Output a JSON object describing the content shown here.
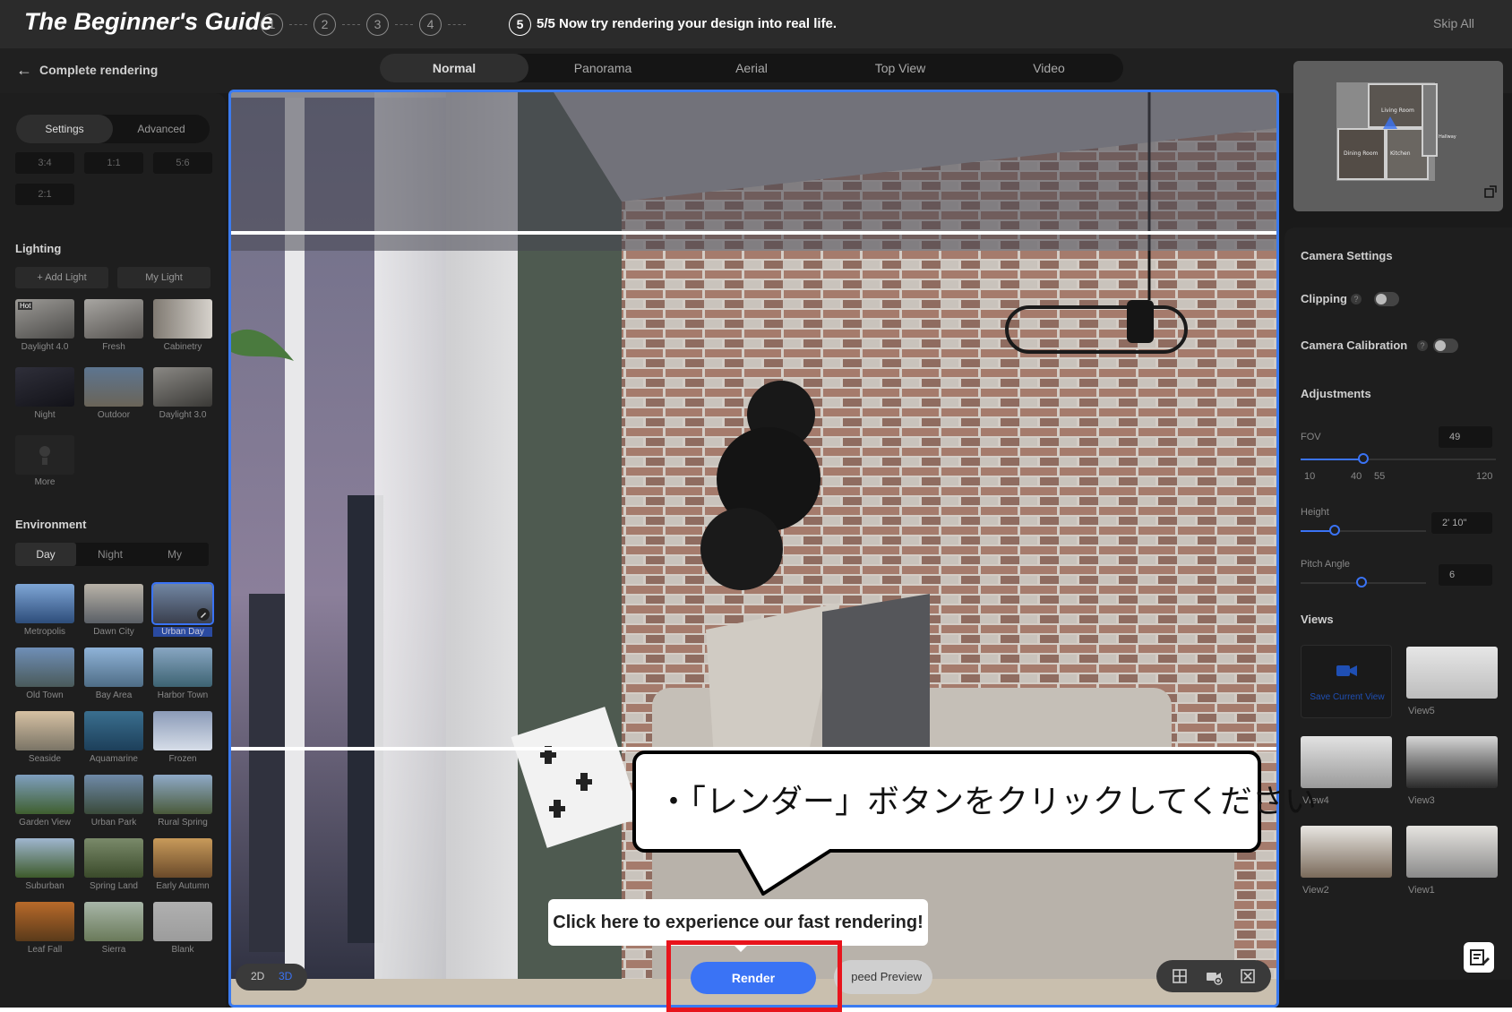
{
  "guide": {
    "title": "The Beginner's Guide",
    "steps": [
      "1",
      "2",
      "3",
      "4",
      "5"
    ],
    "current_text": "5/5 Now try rendering your design into real life.",
    "skip": "Skip All"
  },
  "topbar": {
    "back": "Complete rendering",
    "modes": [
      "Normal",
      "Panorama",
      "Aerial",
      "Top View",
      "Video"
    ]
  },
  "left": {
    "tabs": [
      "Settings",
      "Advanced"
    ],
    "ratios": [
      "3:4",
      "1:1",
      "5:6",
      "2:1"
    ],
    "lighting_title": "Lighting",
    "add_light": "Add Light",
    "my_light": "My Light",
    "hot": "Hot",
    "lights": [
      "Daylight 4.0",
      "Fresh",
      "Cabinetry",
      "Night",
      "Outdoor",
      "Daylight 3.0",
      "More"
    ],
    "environment_title": "Environment",
    "env_tabs": [
      "Day",
      "Night",
      "My"
    ],
    "environments": [
      "Metropolis",
      "Dawn City",
      "Urban Day",
      "Old Town",
      "Bay Area",
      "Harbor Town",
      "Seaside",
      "Aquamarine",
      "Frozen",
      "Garden View",
      "Urban Park",
      "Rural Spring",
      "Suburban",
      "Spring Land",
      "Early Autumn",
      "Leaf Fall",
      "Sierra",
      "Blank"
    ]
  },
  "canvas": {
    "toggle_2d": "2D",
    "toggle_3d": "3D",
    "render": "Render",
    "speed_preview": "peed Preview"
  },
  "tooltip": "Click here to experience our fast rendering!",
  "bubble": "・「レンダー」ボタンをクリックしてください",
  "minimap": {
    "rooms": [
      "Living Room",
      "Dining Room",
      "Kitchen",
      "Hallway"
    ]
  },
  "right": {
    "camera_settings": "Camera Settings",
    "clipping": "Clipping",
    "camera_calibration": "Camera Calibration",
    "help": "?",
    "adjustments": "Adjustments",
    "fov_label": "FOV",
    "fov_value": "49",
    "fov_ticks": [
      "10",
      "40",
      "55",
      "120"
    ],
    "height_label": "Height",
    "height_value": "2' 10\"",
    "pitch_label": "Pitch Angle",
    "pitch_value": "6",
    "views_title": "Views",
    "save_current_view": "Save Current View",
    "views": [
      "View5",
      "View4",
      "View3",
      "View2",
      "View1"
    ]
  },
  "colors": {
    "accent": "#3a73f5",
    "highlight": "#e8141c",
    "panel": "#1e1e1e",
    "canvas_border": "#3b7bf0"
  }
}
